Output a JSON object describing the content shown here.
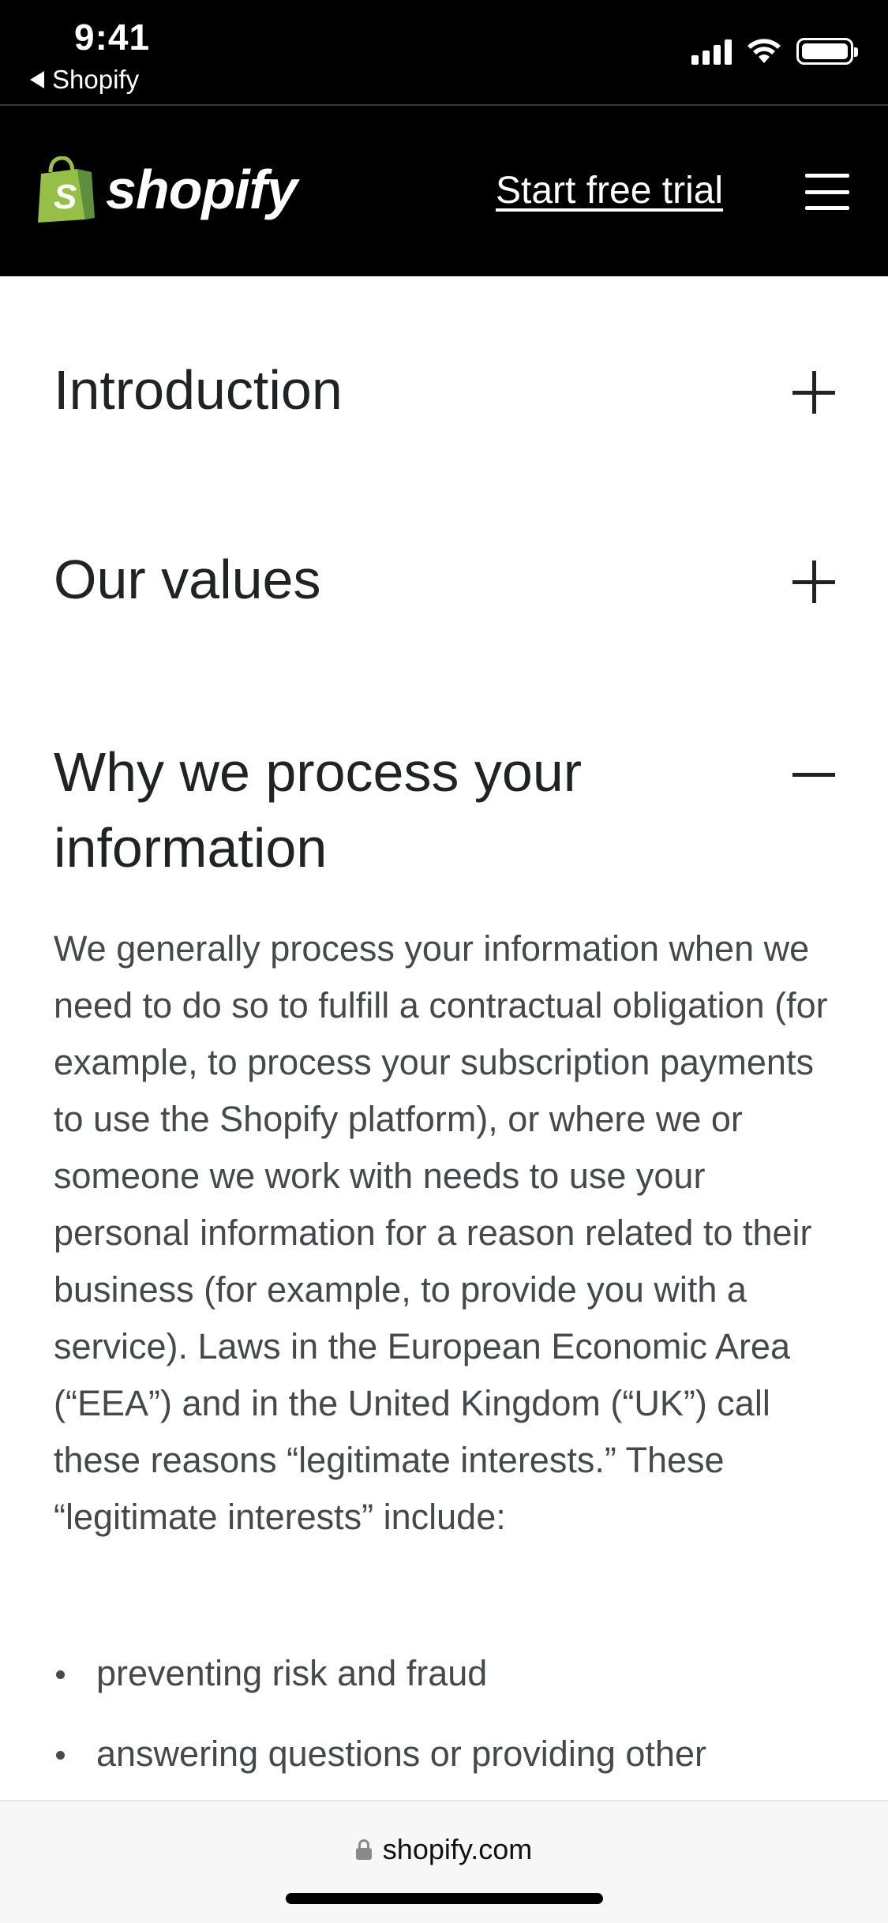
{
  "status_bar": {
    "time": "9:41",
    "back_app": "Shopify"
  },
  "header": {
    "logo_text": "shopify",
    "cta_label": "Start free trial",
    "brand_color": "#95bf47"
  },
  "accordion": [
    {
      "title": "Introduction",
      "state": "collapsed"
    },
    {
      "title": "Our values",
      "state": "collapsed"
    },
    {
      "title": "Why we process your information",
      "state": "expanded"
    }
  ],
  "section_body": "We generally process your information when we need to do so to fulfill a contractual obligation (for example, to process your subscription payments to use the Shopify platform), or where we or someone we work with needs to use your personal information for a reason related to their business (for example, to provide you with a service). Laws in the European Economic Area (“EEA”) and in the United Kingdom (“UK”) call these reasons “legitimate interests.” These “legitimate interests” include:",
  "bullets": [
    "preventing risk and fraud",
    "answering questions or providing other"
  ],
  "browser": {
    "url": "shopify.com"
  },
  "icons": {
    "back": "back-triangle-icon",
    "signal": "cellular-signal-icon",
    "wifi": "wifi-icon",
    "battery": "battery-icon",
    "lock": "lock-icon",
    "menu": "hamburger-menu-icon",
    "expand": "plus-icon",
    "collapse": "minus-icon"
  }
}
